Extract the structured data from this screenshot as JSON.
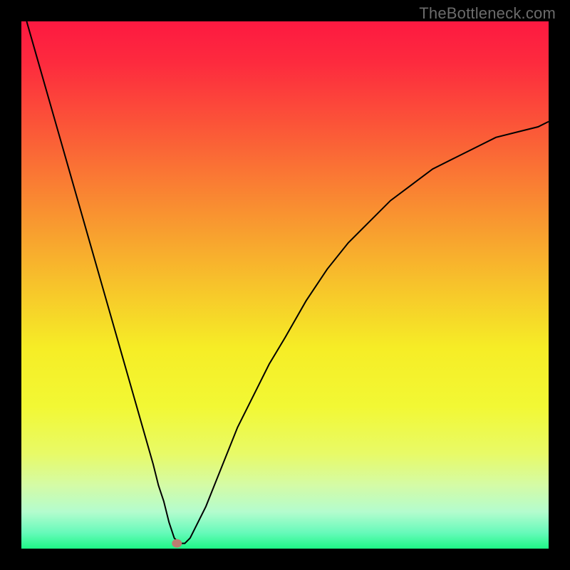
{
  "watermark": "TheBottleneck.com",
  "chart_data": {
    "type": "line",
    "title": "",
    "xlabel": "",
    "ylabel": "",
    "xlim": [
      0,
      100
    ],
    "ylim": [
      0,
      100
    ],
    "grid": false,
    "legend": false,
    "background": "rainbow-vertical-gradient",
    "gradient_stops": [
      {
        "pos": 0.0,
        "color": "#fd1941"
      },
      {
        "pos": 0.08,
        "color": "#fd2b3e"
      },
      {
        "pos": 0.2,
        "color": "#fb5638"
      },
      {
        "pos": 0.35,
        "color": "#f98d31"
      },
      {
        "pos": 0.5,
        "color": "#f7c32b"
      },
      {
        "pos": 0.62,
        "color": "#f6ed26"
      },
      {
        "pos": 0.73,
        "color": "#f2f834"
      },
      {
        "pos": 0.82,
        "color": "#e8fa67"
      },
      {
        "pos": 0.88,
        "color": "#d4fba6"
      },
      {
        "pos": 0.93,
        "color": "#b4fcce"
      },
      {
        "pos": 0.97,
        "color": "#66faba"
      },
      {
        "pos": 1.0,
        "color": "#1ef886"
      }
    ],
    "marker": {
      "x": 29.5,
      "y": 1,
      "color": "#bd7d71",
      "radius": 7
    },
    "series": [
      {
        "name": "curve",
        "color": "#000000",
        "width": 2,
        "x": [
          1,
          3,
          5,
          7,
          9,
          11,
          13,
          15,
          17,
          19,
          21,
          23,
          25,
          26,
          27,
          28,
          29,
          30,
          31,
          32,
          33,
          35,
          37,
          39,
          41,
          44,
          47,
          50,
          54,
          58,
          62,
          66,
          70,
          74,
          78,
          82,
          86,
          90,
          94,
          98,
          100
        ],
        "y": [
          100,
          93,
          86,
          79,
          72,
          65,
          58,
          51,
          44,
          37,
          30,
          23,
          16,
          12,
          9,
          5,
          2,
          1,
          1,
          2,
          4,
          8,
          13,
          18,
          23,
          29,
          35,
          40,
          47,
          53,
          58,
          62,
          66,
          69,
          72,
          74,
          76,
          78,
          79,
          80,
          81
        ]
      }
    ]
  }
}
